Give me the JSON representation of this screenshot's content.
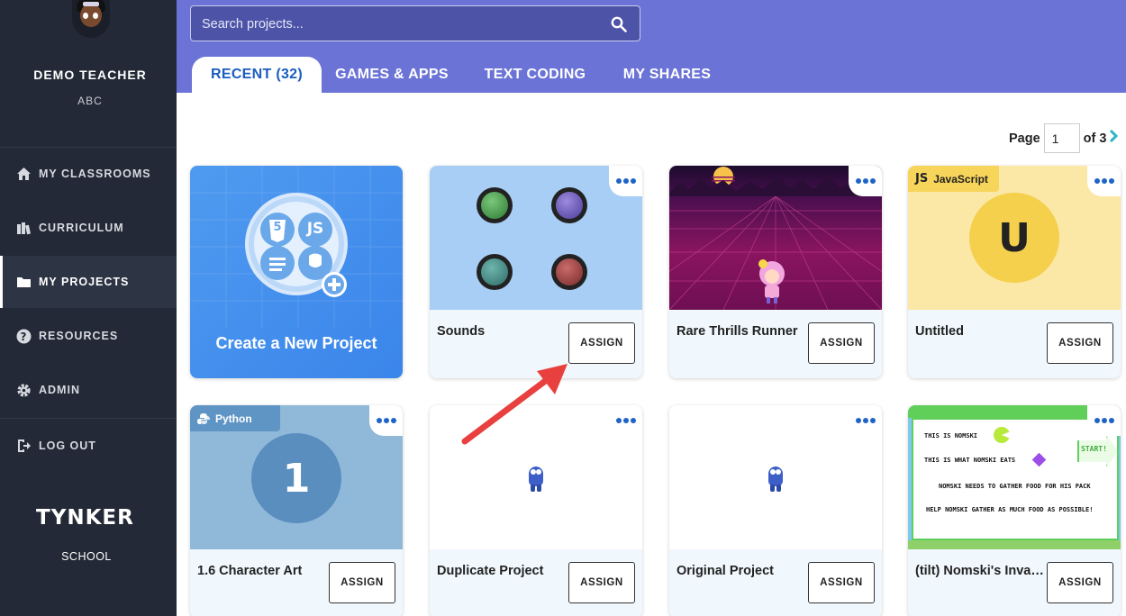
{
  "user": {
    "name": "DEMO TEACHER",
    "subtitle": "ABC"
  },
  "sidebar": {
    "items": [
      {
        "label": "MY CLASSROOMS",
        "icon": "home-icon"
      },
      {
        "label": "CURRICULUM",
        "icon": "books-icon"
      },
      {
        "label": "MY PROJECTS",
        "icon": "folder-icon",
        "active": true
      },
      {
        "label": "RESOURCES",
        "icon": "question-icon"
      },
      {
        "label": "ADMIN",
        "icon": "gear-icon"
      },
      {
        "label": "LOG OUT",
        "icon": "logout-icon"
      }
    ],
    "logo": "TYNKER",
    "logo_sub": "SCHOOL"
  },
  "search": {
    "placeholder": "Search projects..."
  },
  "tabs": [
    {
      "label": "RECENT (32)",
      "active": true
    },
    {
      "label": "GAMES & APPS"
    },
    {
      "label": "TEXT CODING"
    },
    {
      "label": "MY SHARES"
    }
  ],
  "pager": {
    "page_label": "Page",
    "current": "1",
    "of_label": "of 3"
  },
  "create_card": {
    "label": "Create a New Project",
    "icon_labels": [
      "5",
      "JS"
    ]
  },
  "projects": [
    {
      "title": "Sounds",
      "assign": "ASSIGN"
    },
    {
      "title": "Rare Thrills Runner",
      "assign": "ASSIGN"
    },
    {
      "title": "Untitled",
      "assign": "ASSIGN",
      "badge": "JS",
      "badge_text": "JavaScript",
      "letter": "U"
    },
    {
      "title": "1.6 Character Art",
      "assign": "ASSIGN",
      "badge_text": "Python",
      "letter": "1"
    },
    {
      "title": "Duplicate Project",
      "assign": "ASSIGN"
    },
    {
      "title": "Original Project",
      "assign": "ASSIGN"
    },
    {
      "title": "(tilt) Nomski's Invasion",
      "assign": "ASSIGN",
      "thumb_lines": [
        "This is Nomski",
        "This is what Nomski eats",
        "Nomski needs to gather food for his pack",
        "Help Nomski gather as much food as possible!"
      ],
      "start": "START!"
    }
  ],
  "colors": {
    "header": "#6b73d6",
    "sidebar": "#232936",
    "accent": "#1a5dbf",
    "arrow": "#e8403f"
  }
}
